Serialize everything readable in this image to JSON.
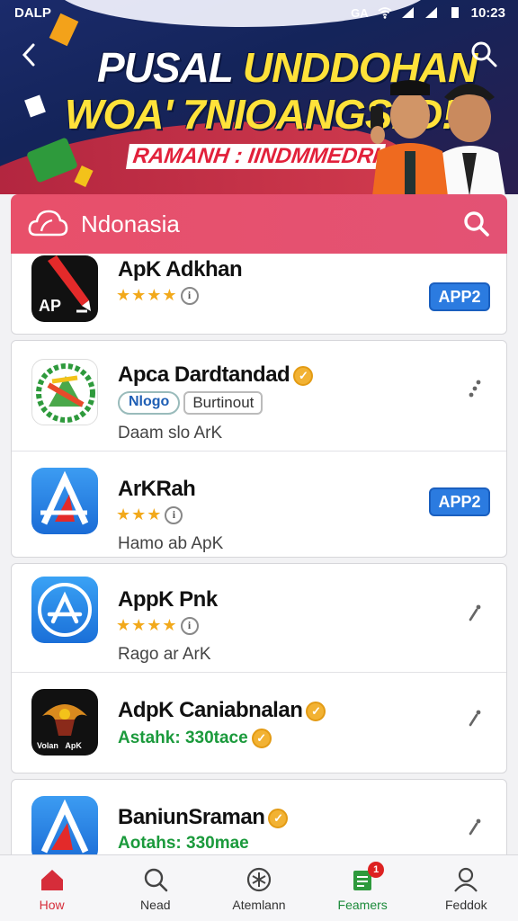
{
  "status_bar": {
    "carrier": "DALP",
    "icons_left": "GA",
    "time": "10:23"
  },
  "banner": {
    "headline_word1": "PUSAL",
    "headline_word2": "UNDDOHAN",
    "headline_line2": "WOA' 7NIOANGSI D!",
    "subheadline": "RAMANH : IINDMMEDRI"
  },
  "search": {
    "placeholder": "Ndonasia"
  },
  "apps": [
    {
      "title": "ApK Adkhan",
      "rating": 4,
      "button": "APP2"
    },
    {
      "title": "Apca Dardtandad",
      "tag1": "Nlogo",
      "tag2": "Burtinout",
      "subtitle": "Daam slo ArK"
    },
    {
      "title": "ArKRah",
      "rating": 3,
      "button": "APP2",
      "subtitle": "Hamo ab ApK"
    },
    {
      "title": "AppK Pnk",
      "rating": 4,
      "subtitle": "Rago ar ArK"
    },
    {
      "title": "AdpK Caniabnalan",
      "subtitle": "Astahk: 330tace"
    },
    {
      "title": "BaniunSraman",
      "subtitle": "Aotahs: 330mae"
    }
  ],
  "bottom_nav": [
    {
      "label": "Ноw"
    },
    {
      "label": "Nead"
    },
    {
      "label": "Atemlann"
    },
    {
      "label": "Feamers",
      "badge": "1"
    },
    {
      "label": "Feddok"
    }
  ],
  "colors": {
    "accent": "#e8506a",
    "button_blue": "#2b7be0",
    "active_nav": "#d62d3a",
    "star": "#f2a91b"
  }
}
